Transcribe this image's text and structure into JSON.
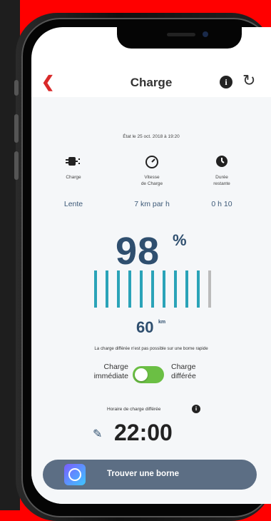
{
  "header": {
    "title": "Charge",
    "back_icon": "chevron-left-icon",
    "info_icon": "info-icon",
    "refresh_icon": "refresh-icon"
  },
  "state_date": "État le 25 oct. 2018 à 19:20",
  "stats": [
    {
      "icon": "plug-icon",
      "label": "Charge",
      "value": "Lente"
    },
    {
      "icon": "speedometer-icon",
      "label": "Vitesse\nde Charge",
      "value": "7 km par h"
    },
    {
      "icon": "clock-icon",
      "label": "Durée\nrestante",
      "value": "0 h 10"
    }
  ],
  "battery": {
    "percent": "98",
    "percent_sign": "%",
    "bars_total": 11,
    "bars_filled": 10
  },
  "range": {
    "value": "60",
    "unit": "km"
  },
  "note": "La charge différée n'est pas possible sur une borne rapide",
  "toggle": {
    "left": "Charge\nimmédiate",
    "right": "Charge\ndifférée",
    "state": "on"
  },
  "schedule": {
    "label": "Horaire de charge différée",
    "time": "22:00"
  },
  "cta": {
    "label": "Trouver une borne"
  },
  "colors": {
    "accent": "#2aa3b8",
    "toggle": "#6bbf44",
    "cta": "#5c6e84",
    "back": "#d92a2a"
  }
}
